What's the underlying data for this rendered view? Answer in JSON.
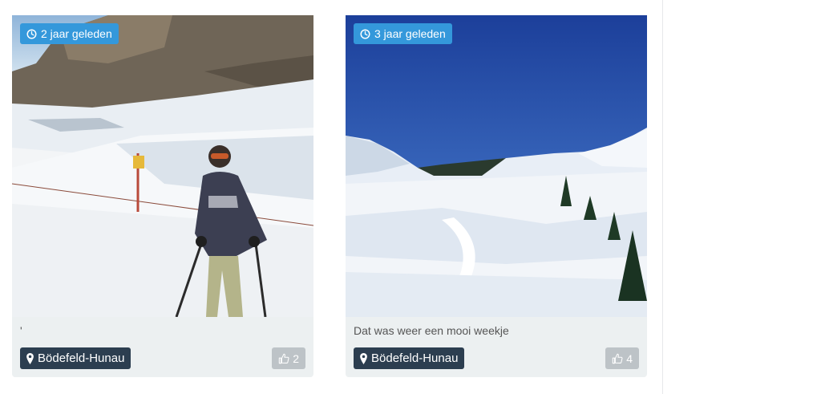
{
  "posts": [
    {
      "time_ago": "2 jaar geleden",
      "caption": "'",
      "location": "Bödefeld-Hunau",
      "likes": "2",
      "time_icon": "clock-icon",
      "location_icon": "map-marker-icon",
      "like_icon": "thumbs-up-icon",
      "image": "photo of a skier in a patterned sweater and helmet standing on a snowy slope below rocky cliffs"
    },
    {
      "time_ago": "3 jaar geleden",
      "caption": "Dat was weer een mooi weekje",
      "location": "Bödefeld-Hunau",
      "likes": "4",
      "time_icon": "clock-icon",
      "location_icon": "map-marker-icon",
      "like_icon": "thumbs-up-icon",
      "image": "photo of a snowy alpine landscape under a deep blue sky with pine trees and ski tracks"
    }
  ],
  "colors": {
    "time_badge": "#3498db",
    "location_badge": "#2c3e50",
    "like_button": "#bdc3c7",
    "card_background": "#ecf0f1"
  }
}
